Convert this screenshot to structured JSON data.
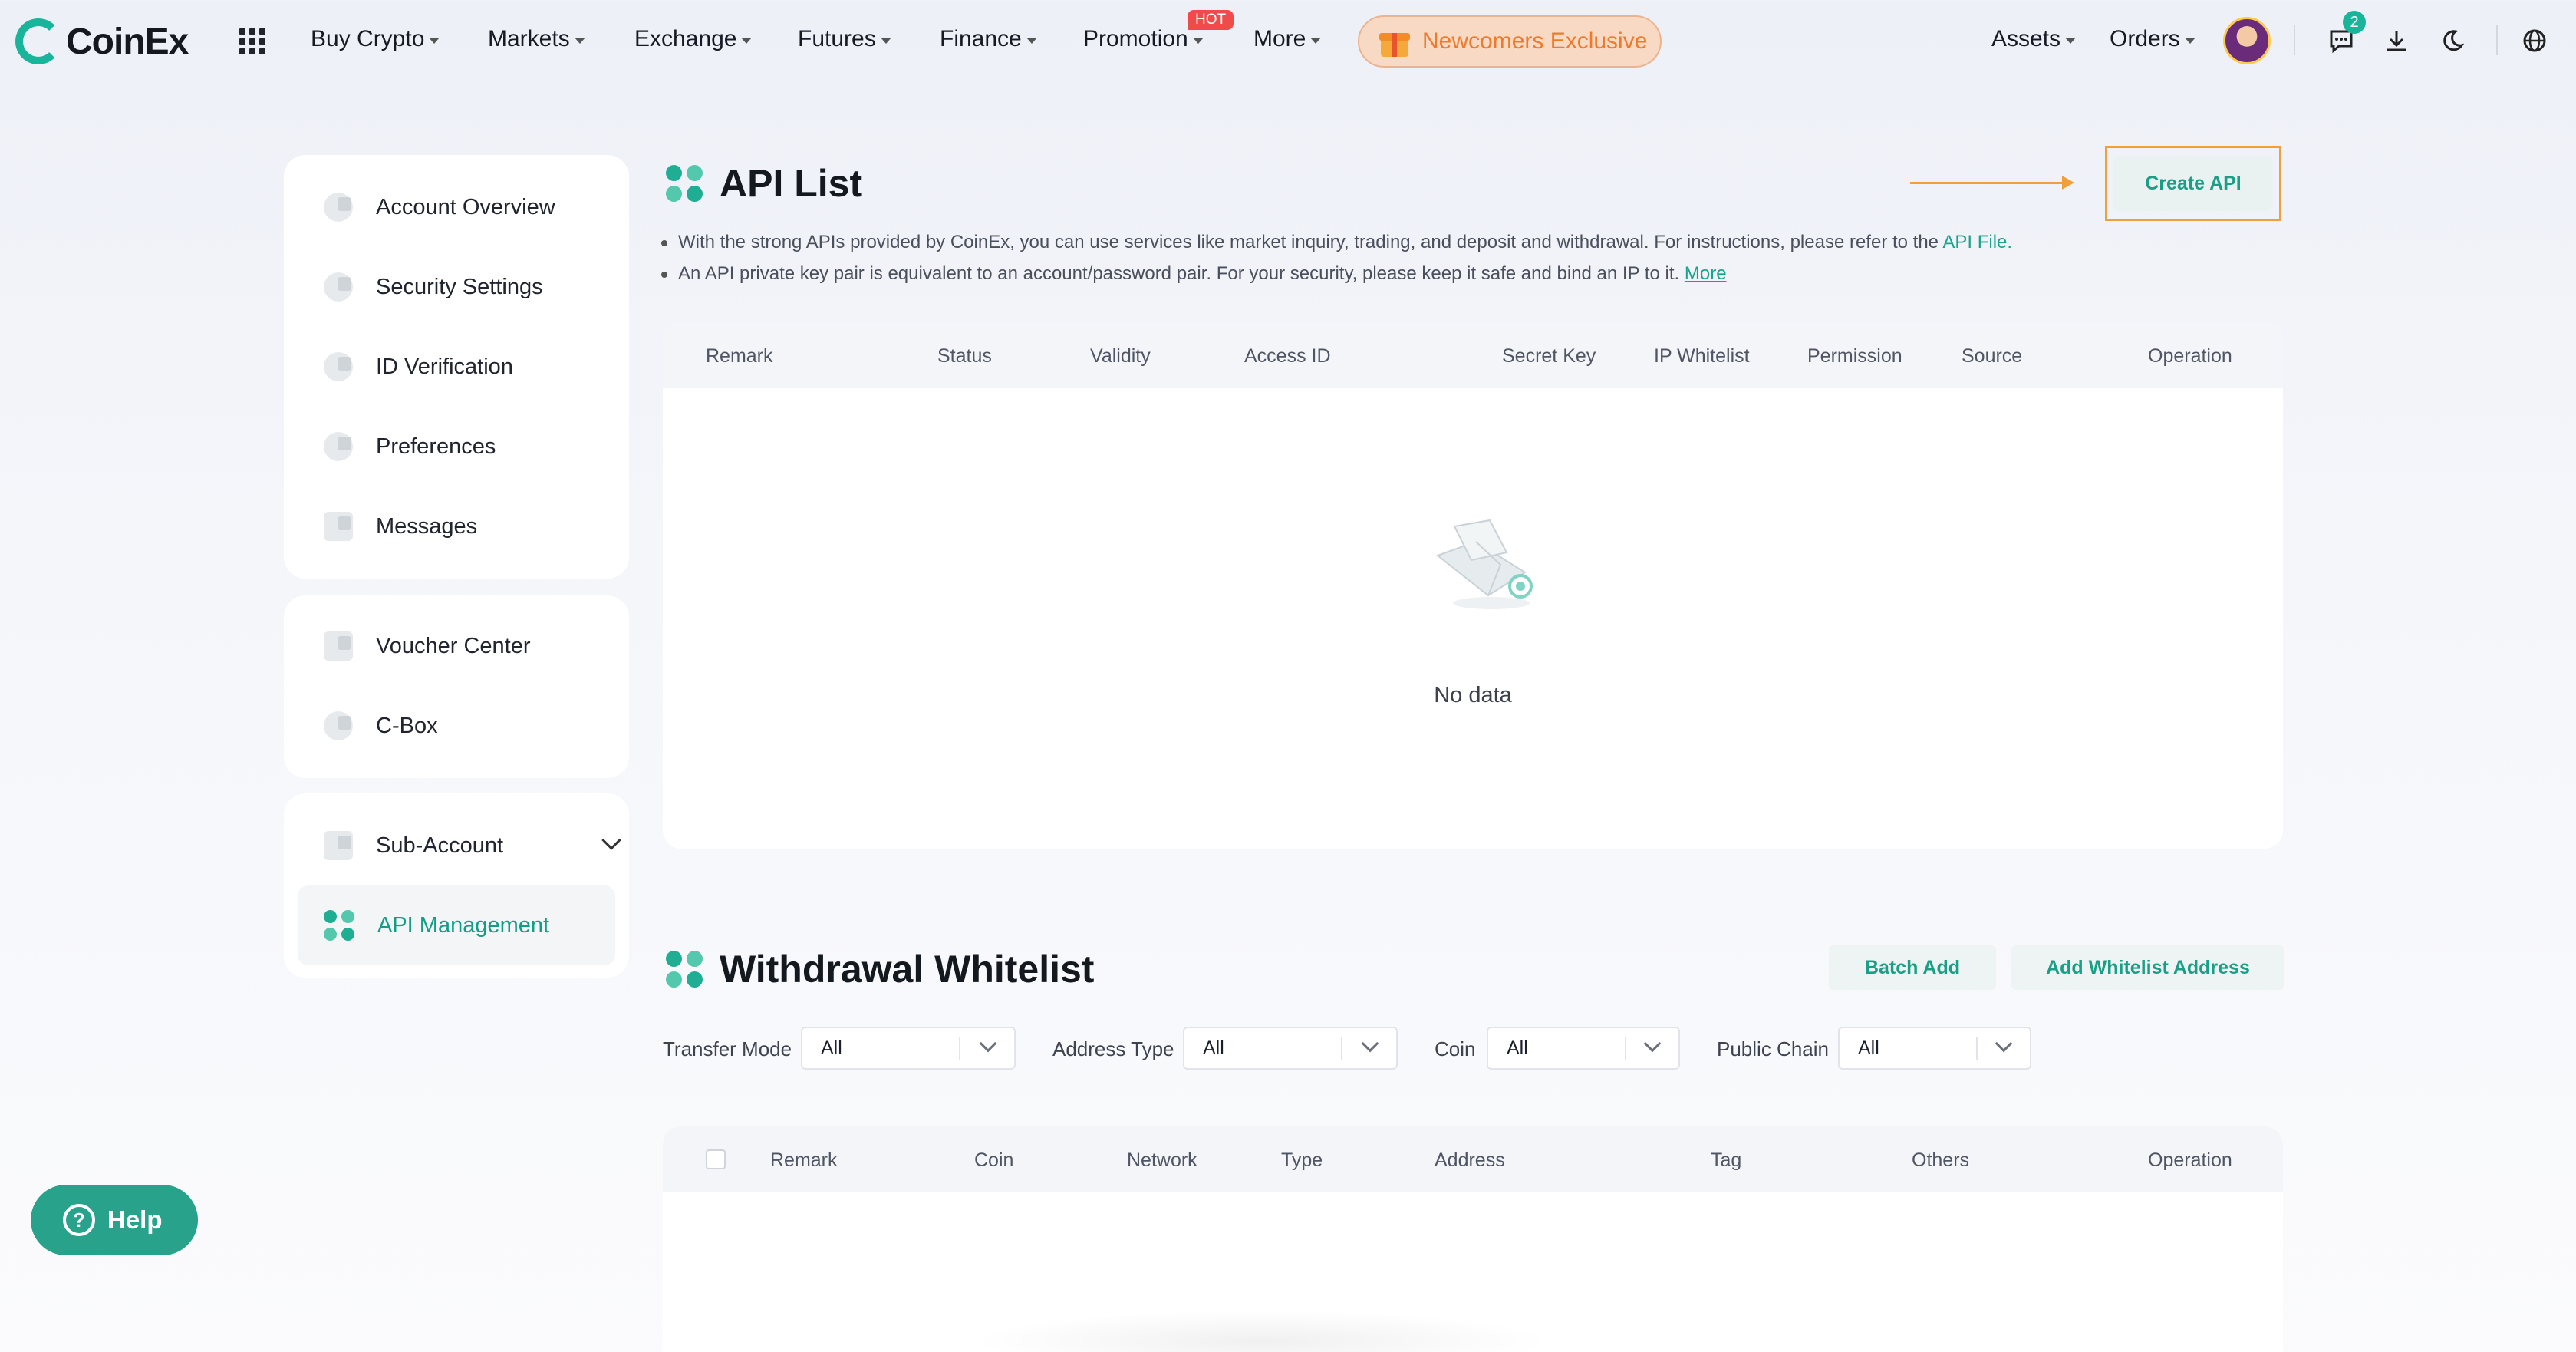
{
  "header": {
    "logo_text": "CoinEx",
    "nav": [
      "Buy Crypto",
      "Markets",
      "Exchange",
      "Futures",
      "Finance",
      "Promotion",
      "More"
    ],
    "hot_badge": "HOT",
    "newcomers": "Newcomers Exclusive",
    "assets": "Assets",
    "orders": "Orders",
    "message_count": "2"
  },
  "sidebar": {
    "group1": [
      "Account Overview",
      "Security Settings",
      "ID Verification",
      "Preferences",
      "Messages"
    ],
    "group2": [
      "Voucher Center",
      "C-Box"
    ],
    "group3": [
      "Sub-Account",
      "API Management"
    ]
  },
  "api_list": {
    "title": "API List",
    "note1_text": "With the strong APIs provided by CoinEx, you can use services like market inquiry, trading, and deposit and withdrawal. For instructions, please refer to the",
    "note1_link": "API File.",
    "note2_text": "An API private key pair is equivalent to an account/password pair. For your security, please keep it safe and bind an IP to it.",
    "note2_link": "More",
    "create_button": "Create API",
    "columns": [
      "Remark",
      "Status",
      "Validity",
      "Access ID",
      "Secret Key",
      "IP Whitelist",
      "Permission",
      "Source",
      "Operation"
    ],
    "empty_text": "No data"
  },
  "whitelist": {
    "title": "Withdrawal Whitelist",
    "batch_add": "Batch Add",
    "add_address": "Add Whitelist Address",
    "filters": [
      {
        "label": "Transfer Mode",
        "value": "All"
      },
      {
        "label": "Address Type",
        "value": "All"
      },
      {
        "label": "Coin",
        "value": "All"
      },
      {
        "label": "Public Chain",
        "value": "All"
      }
    ],
    "columns": [
      "Remark",
      "Coin",
      "Network",
      "Type",
      "Address",
      "Tag",
      "Others",
      "Operation"
    ]
  },
  "help": {
    "label": "Help"
  },
  "colors": {
    "brand": "#19b59a",
    "accent_orange": "#f0a03a",
    "hot_red": "#f04b4b"
  }
}
